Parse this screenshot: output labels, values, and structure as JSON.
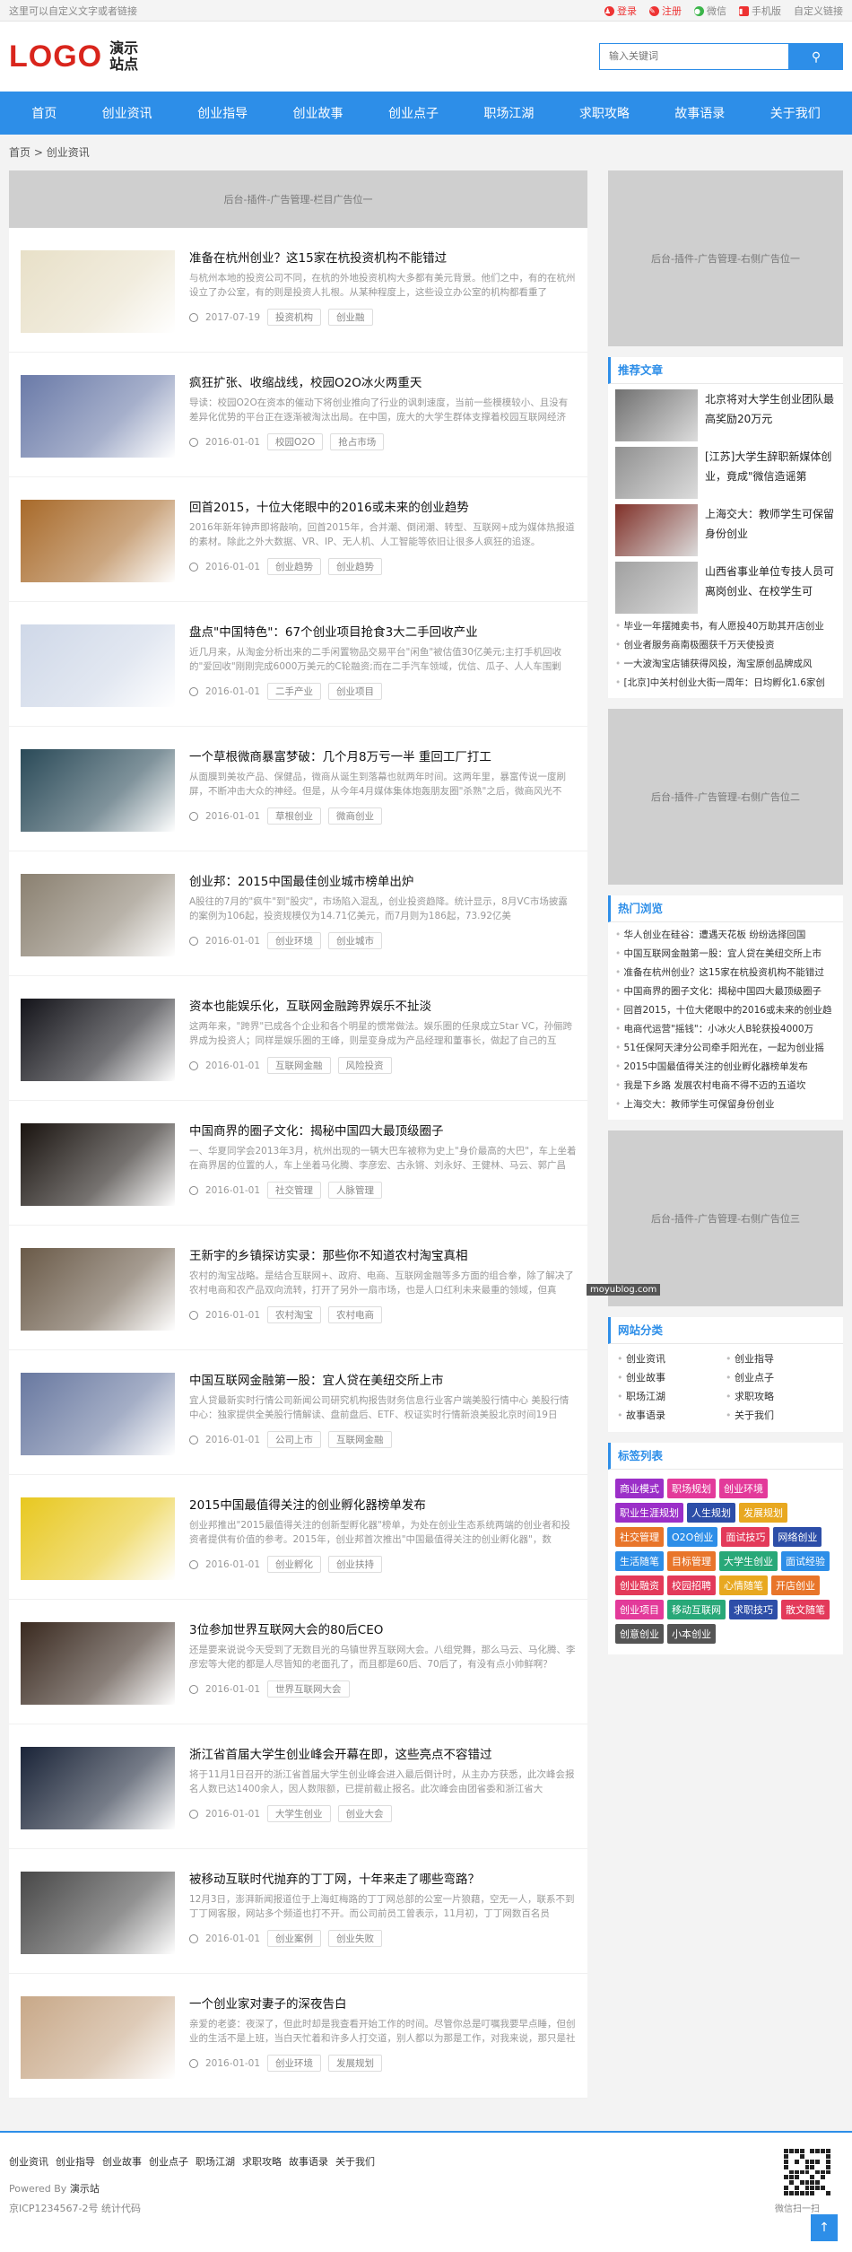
{
  "topbar": {
    "left": "这里可以自定义文字或者链接",
    "login": "登录",
    "register": "注册",
    "wechat": "微信",
    "mobile": "手机版",
    "custom_link": "自定义链接"
  },
  "header": {
    "logo": "LOGO",
    "logo_sub": "演示站点",
    "search_placeholder": "输入关键词"
  },
  "nav": [
    "首页",
    "创业资讯",
    "创业指导",
    "创业故事",
    "创业点子",
    "职场江湖",
    "求职攻略",
    "故事语录",
    "关于我们"
  ],
  "breadcrumb": {
    "home": "首页",
    "sep": ">",
    "current": "创业资讯"
  },
  "ads": {
    "top": "后台-插件-广告管理-栏目广告位一",
    "right1": "后台-插件-广告管理-右侧广告位一",
    "right2": "后台-插件-广告管理-右侧广告位二",
    "right3": "后台-插件-广告管理-右侧广告位三"
  },
  "posts": [
    {
      "title": "准备在杭州创业？这15家在杭投资机构不能错过",
      "desc": "与杭州本地的投资公司不同，在杭的外地投资机构大多都有美元背景。他们之中，有的在杭州设立了办公室，有的则是投资人扎根。从某种程度上，这些设立办公室的机构都看重了",
      "date": "2017-07-19",
      "tags": [
        "投资机构",
        "创业融"
      ],
      "c": "#e8e0c8"
    },
    {
      "title": "疯狂扩张、收缩战线，校园O2O冰火两重天",
      "desc": "导读：校园O2O在资本的催动下将创业推向了行业的讽刺速度，当前一些模模较小、且没有差异化优势的平台正在逐渐被淘汰出局。在中国，庞大的大学生群体支撑着校园互联网经济",
      "date": "2016-01-01",
      "tags": [
        "校园O2O",
        "抢占市场"
      ],
      "c": "#6a7aa8"
    },
    {
      "title": "回首2015，十位大佬眼中的2016或未来的创业趋势",
      "desc": "2016年新年钟声即将敲响，回首2015年，合并潮、倒闭潮、转型、互联网+成为媒体热报道的素材。除此之外大数据、VR、IP、无人机、人工智能等依旧让很多人疯狂的追逐。",
      "date": "2016-01-01",
      "tags": [
        "创业趋势",
        "创业趋势"
      ],
      "c": "#a86a2a"
    },
    {
      "title": "盘点\"中国特色\"：67个创业项目抢食3大二手回收产业",
      "desc": "近几月来，从淘金分析出来的二手闲置物品交易平台\"闲鱼\"被估值30亿美元;主打手机回收的\"爱回收\"刚刚完成6000万美元的C轮融资;而在二手汽车领域，优信、瓜子、人人车围剿",
      "date": "2016-01-01",
      "tags": [
        "二手产业",
        "创业项目"
      ],
      "c": "#cfd8e8"
    },
    {
      "title": "一个草根微商暴富梦破：几个月8万亏一半 重回工厂打工",
      "desc": "从面膜到美妆产品、保健品，微商从诞生到落幕也就两年时间。这两年里，暴富传说一度刷屏，不断冲击大众的神经。但是，从今年4月媒体集体炮轰朋友圈\"杀熟\"之后，微商风光不",
      "date": "2016-01-01",
      "tags": [
        "草根创业",
        "微商创业"
      ],
      "c": "#2a4a58"
    },
    {
      "title": "创业邦：2015中国最佳创业城市榜单出炉",
      "desc": "A股往的7月的\"疯牛\"到\"股灾\"，市场陷入混乱，创业投资趋降。统计显示，8月VC市场披露的案例为106起，投资规模仅为14.71亿美元，而7月则为186起，73.92亿美",
      "date": "2016-01-01",
      "tags": [
        "创业环境",
        "创业城市"
      ],
      "c": "#8a8070"
    },
    {
      "title": "资本也能娱乐化，互联网金融跨界娱乐不扯淡",
      "desc": "这两年来，\"跨界\"已成各个企业和各个明星的惯常做法。娱乐圈的任泉成立Star VC，孙俪跨界成为投资人；同样是娱乐圈的王峰，则是变身成为产品经理和董事长，做起了自己的互",
      "date": "2016-01-01",
      "tags": [
        "互联网金融",
        "风险投资"
      ],
      "c": "#14141a"
    },
    {
      "title": "中国商界的圈子文化：揭秘中国四大最顶级圈子",
      "desc": "一、华夏同学会2013年3月，杭州出现的一辆大巴车被称为史上\"身价最高的大巴\"，车上坐着在商界居的位置的人，车上坐着马化腾、李彦宏、古永锵、刘永好、王健林、马云、郭广昌",
      "date": "2016-01-01",
      "tags": [
        "社交管理",
        "人脉管理"
      ],
      "c": "#1a1410"
    },
    {
      "title": "王新宇的乡镇探访实录：那些你不知道农村淘宝真相",
      "desc": "农村的淘宝战略。是结合互联网+、政府、电商、互联网金融等多方面的组合拳，除了解决了农村电商和农产品双向流转，打开了另外一扇市场，也是人口红利未来最重的领域，但真",
      "date": "2016-01-01",
      "tags": [
        "农村淘宝",
        "农村电商"
      ],
      "c": "#6a5a48"
    },
    {
      "title": "中国互联网金融第一股：宜人贷在美纽交所上市",
      "desc": "宜人贷最新实时行情公司新闻公司研究机构报告财务信息行业客户端美股行情中心 美股行情中心：独家提供全美股行情解读、盘前盘后、ETF、权证实时行情新浪美股北京时间19日",
      "date": "2016-01-01",
      "tags": [
        "公司上市",
        "互联网金融"
      ],
      "c": "#6878a0"
    },
    {
      "title": "2015中国最值得关注的创业孵化器榜单发布",
      "desc": "创业邦推出\"2015最值得关注的创新型孵化器\"榜单，为处在创业生态系统两端的创业者和投资者提供有价值的参考。2015年，创业邦首次推出\"中国最值得关注的创业孵化器\"，数",
      "date": "2016-01-01",
      "tags": [
        "创业孵化",
        "创业扶持"
      ],
      "c": "#e8c820"
    },
    {
      "title": "3位参加世界互联网大会的80后CEO",
      "desc": "还是要来说说今天受到了无数目光的乌镇世界互联网大会。八组党舞，那么马云、马化腾、李彦宏等大佬的都是人尽皆知的老面孔了，而且都是60后、70后了，有没有点小帅鲜啊？",
      "date": "2016-01-01",
      "tags": [
        "世界互联网大会"
      ],
      "c": "#3a2a20"
    },
    {
      "title": "浙江省首届大学生创业峰会开幕在即，这些亮点不容错过",
      "desc": "将于11月1日召开的浙江省首届大学生创业峰会进入最后倒计时，从主办方获悉，此次峰会报名人数已达1400余人，因人数限额，已提前截止报名。此次峰会由团省委和浙江省大",
      "date": "2016-01-01",
      "tags": [
        "大学生创业",
        "创业大会"
      ],
      "c": "#1a2438"
    },
    {
      "title": "被移动互联时代抛弃的丁丁网，十年来走了哪些弯路？",
      "desc": "12月3日，澎湃新闻报道位于上海虹梅路的丁丁网总部的公室一片狼藉，空无一人，联系不到丁丁网客服，网站多个频道也打不开。而公司前员工曾表示，11月初，丁丁网数百名员",
      "date": "2016-01-01",
      "tags": [
        "创业案例",
        "创业失败"
      ],
      "c": "#484848"
    },
    {
      "title": "一个创业家对妻子的深夜告白",
      "desc": "亲爱的老婆：夜深了，但此时却是我查看开始工作的时间。尽管你总是叮嘱我要早点睡，但创业的生活不是上班，当白天忙着和许多人打交道，别人都以为那是工作，对我来说，那只是社",
      "date": "2016-01-01",
      "tags": [
        "创业环境",
        "发展规划"
      ],
      "c": "#c8a888"
    }
  ],
  "recommend": {
    "title": "推荐文章",
    "items": [
      {
        "t": "北京将对大学生创业团队最高奖励20万元",
        "c": "#707070"
      },
      {
        "t": "[江苏]大学生辞职新媒体创业，竟成\"微信造谣第",
        "c": "#909090"
      },
      {
        "t": "上海交大：教师学生可保留身份创业",
        "c": "#803028"
      },
      {
        "t": "山西省事业单位专技人员可离岗创业、在校学生可",
        "c": "#a0a0a0"
      }
    ],
    "list": [
      "毕业一年摆摊卖书，有人愿投40万助其开店创业",
      "创业者服务商南极圈获千万天使投资",
      "一大波淘宝店铺获得风投，淘宝原创品牌成风",
      "[北京]中关村创业大街一周年：日均孵化1.6家创"
    ]
  },
  "hot": {
    "title": "热门浏览",
    "list": [
      "华人创业在硅谷：遭遇天花板 纷纷选择回国",
      "中国互联网金融第一股：宜人贷在美纽交所上市",
      "准备在杭州创业？这15家在杭投资机构不能错过",
      "中国商界的圈子文化：揭秘中国四大最顶级圈子",
      "回首2015，十位大佬眼中的2016或未来的创业趋",
      "电商代运营\"摇钱\"：小冰火人B轮获投4000万",
      "51任保阿天津分公司牵手阳光在，一起为创业摇",
      "2015中国最值得关注的创业孵化器榜单发布",
      "我是下乡路 发展农村电商不得不迈的五道坎",
      "上海交大：教师学生可保留身份创业"
    ]
  },
  "cats": {
    "title": "网站分类",
    "items": [
      "创业资讯",
      "创业指导",
      "创业故事",
      "创业点子",
      "职场江湖",
      "求职攻略",
      "故事语录",
      "关于我们"
    ]
  },
  "tags": {
    "title": "标签列表",
    "items": [
      {
        "n": "商业模式",
        "c": "#9b2fc8"
      },
      {
        "n": "职场规划",
        "c": "#e33a9a"
      },
      {
        "n": "创业环境",
        "c": "#e33a9a"
      },
      {
        "n": "职业生涯规划",
        "c": "#9b2fc8"
      },
      {
        "n": "人生规划",
        "c": "#2d4ea8"
      },
      {
        "n": "发展规划",
        "c": "#e8a820"
      },
      {
        "n": "社交管理",
        "c": "#e8752a"
      },
      {
        "n": "O2O创业",
        "c": "#2d8ee8"
      },
      {
        "n": "面试技巧",
        "c": "#e33a5a"
      },
      {
        "n": "网络创业",
        "c": "#2d4ea8"
      },
      {
        "n": "生活随笔",
        "c": "#2d8ee8"
      },
      {
        "n": "目标管理",
        "c": "#e8752a"
      },
      {
        "n": "大学生创业",
        "c": "#28a878"
      },
      {
        "n": "面试经验",
        "c": "#2d8ee8"
      },
      {
        "n": "创业融资",
        "c": "#e33a5a"
      },
      {
        "n": "校园招聘",
        "c": "#e33a5a"
      },
      {
        "n": "心情随笔",
        "c": "#e8a820"
      },
      {
        "n": "开店创业",
        "c": "#e8752a"
      },
      {
        "n": "创业项目",
        "c": "#e33a9a"
      },
      {
        "n": "移动互联网",
        "c": "#28a878"
      },
      {
        "n": "求职技巧",
        "c": "#2d4ea8"
      },
      {
        "n": "散文随笔",
        "c": "#e33a5a"
      },
      {
        "n": "创意创业",
        "c": "#555555"
      },
      {
        "n": "小本创业",
        "c": "#555555"
      }
    ]
  },
  "footer": {
    "links": [
      "创业资讯",
      "创业指导",
      "创业故事",
      "创业点子",
      "职场江湖",
      "求职攻略",
      "故事语录",
      "关于我们"
    ],
    "powered": "Powered By",
    "powered_name": "演示站",
    "icp": "京ICP1234567-2号 统计代码",
    "qr_text": "微信扫一扫",
    "watermark": "moyublog.com",
    "totop": "↑"
  }
}
